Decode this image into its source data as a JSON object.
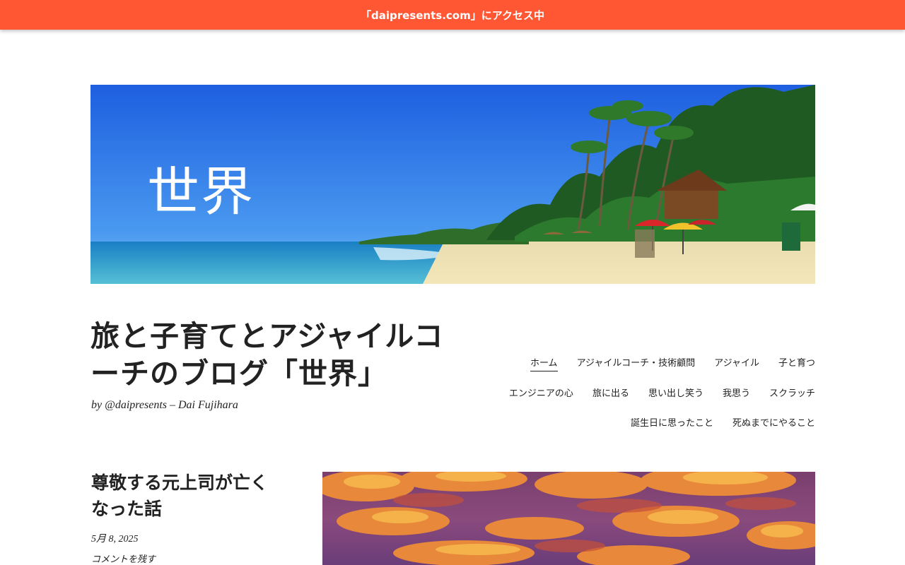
{
  "access_bar": {
    "text": "「daipresents.com」にアクセス中"
  },
  "banner": {
    "overlay_text": "世界"
  },
  "site": {
    "title": "旅と子育てとアジャイルコーチのブログ「世界」",
    "description": "by @daipresents – Dai Fujihara"
  },
  "nav": {
    "items": [
      {
        "label": "ホーム",
        "active": true
      },
      {
        "label": "アジャイルコーチ・技術顧問"
      },
      {
        "label": "アジャイル"
      },
      {
        "label": "子と育つ"
      },
      {
        "label": "エンジニアの心"
      },
      {
        "label": "旅に出る"
      },
      {
        "label": "思い出し笑う"
      },
      {
        "label": "我思う"
      },
      {
        "label": "スクラッチ"
      },
      {
        "label": "誕生日に思ったこと"
      },
      {
        "label": "死ぬまでにやること"
      }
    ]
  },
  "post": {
    "title": "尊敬する元上司が亡くなった話",
    "date": "5月 8, 2025",
    "comment_link": "コメントを残す"
  },
  "colors": {
    "access_bar_bg": "#ff5733",
    "text": "#222222"
  }
}
